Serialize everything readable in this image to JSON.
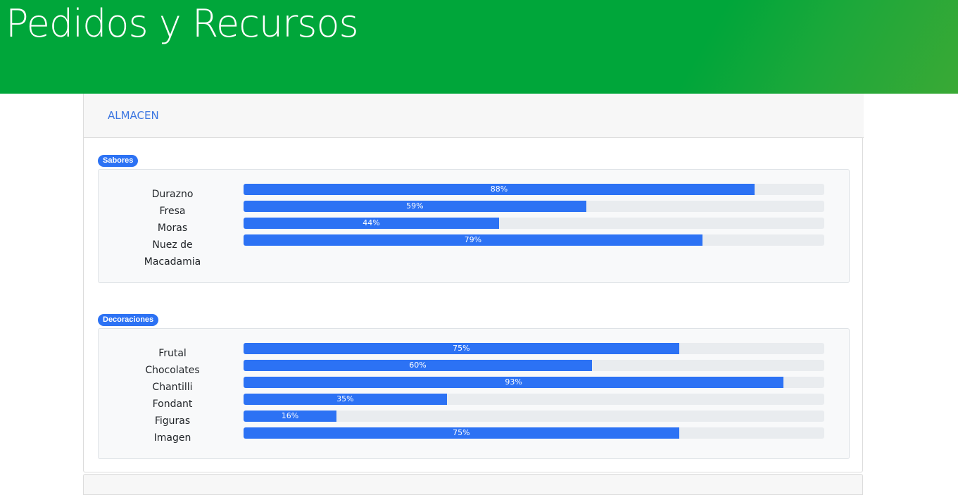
{
  "header": {
    "title": "Pedidos y Recursos",
    "background_color": "#00a63a"
  },
  "card": {
    "tab_label": "ALMACEN",
    "accent_color": "#2c72f4"
  },
  "groups": [
    {
      "badge": "Sabores",
      "items": [
        {
          "label": "Durazno",
          "percent": 88,
          "percent_label": "88%"
        },
        {
          "label": "Fresa",
          "percent": 59,
          "percent_label": "59%"
        },
        {
          "label": "Moras",
          "percent": 44,
          "percent_label": "44%"
        },
        {
          "label": "Nuez de Macadamia",
          "percent": 79,
          "percent_label": "79%"
        }
      ]
    },
    {
      "badge": "Decoraciones",
      "items": [
        {
          "label": "Frutal",
          "percent": 75,
          "percent_label": "75%"
        },
        {
          "label": "Chocolates",
          "percent": 60,
          "percent_label": "60%"
        },
        {
          "label": "Chantilli",
          "percent": 93,
          "percent_label": "93%"
        },
        {
          "label": "Fondant",
          "percent": 35,
          "percent_label": "35%"
        },
        {
          "label": "Figuras",
          "percent": 16,
          "percent_label": "16%"
        },
        {
          "label": "Imagen",
          "percent": 75,
          "percent_label": "75%"
        }
      ]
    }
  ]
}
